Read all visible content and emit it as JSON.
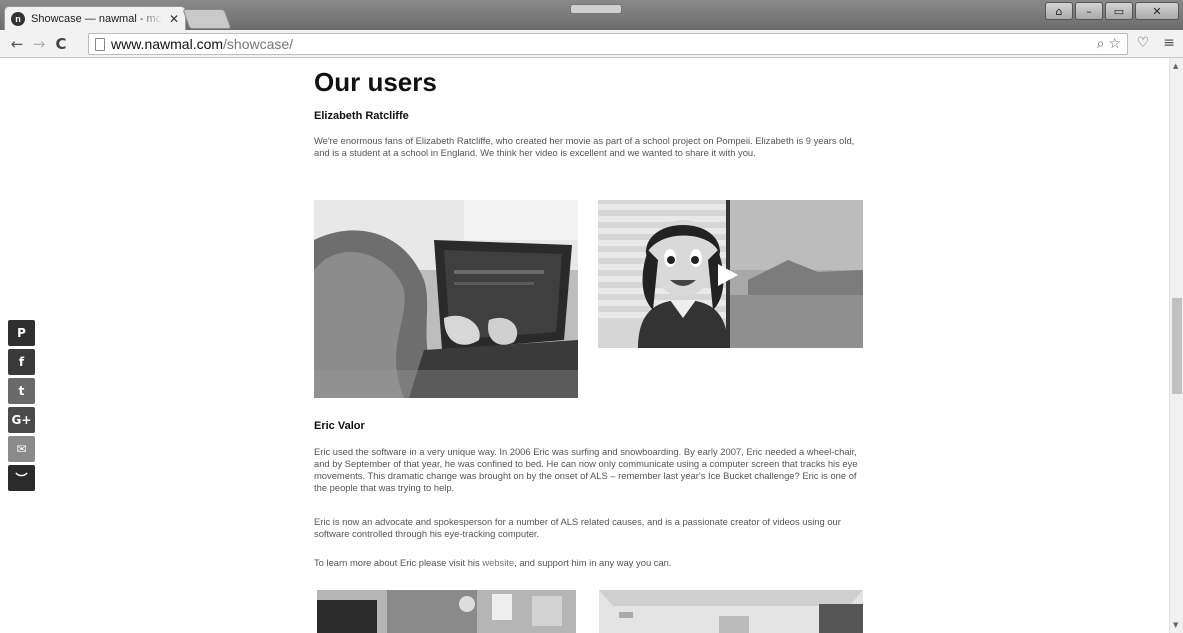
{
  "browser": {
    "tab_title": "Showcase — nawmal - mc",
    "tab_close": "✕",
    "favicon_letter": "n",
    "url_host": "www.nawmal.com",
    "url_path": "/showcase/",
    "window_controls": {
      "user": "⌂",
      "minimize": "–",
      "maximize": "▭",
      "close": "✕"
    },
    "icons": {
      "back": "←",
      "forward": "→",
      "reload": "C",
      "zoom": "⌕",
      "star": "☆",
      "pocket": "♡",
      "menu": "≡"
    }
  },
  "share": [
    {
      "name": "pinterest",
      "glyph": "P",
      "color": "#2f2f2f"
    },
    {
      "name": "facebook",
      "glyph": "f",
      "color": "#3a3a3a"
    },
    {
      "name": "twitter",
      "glyph": "t",
      "color": "#6a6a6a"
    },
    {
      "name": "google-plus",
      "glyph": "G+",
      "color": "#4a4a4a"
    },
    {
      "name": "email",
      "glyph": "✉",
      "color": "#8a8a8a"
    },
    {
      "name": "sumome",
      "glyph": "︶",
      "color": "#2a2a2a"
    }
  ],
  "page": {
    "heading": "Our users",
    "user1": {
      "name": "Elizabeth Ratcliffe",
      "bio": "We're enormous fans of Elizabeth Ratcliffe, who created her movie as part of a school project on Pompeii. Elizabeth is 9 years old, and is a student at a school in England. We think her video is excellent and we wanted to share it with you."
    },
    "user2": {
      "name": "Eric Valor",
      "bio1": "Eric used the software in a very unique way. In 2006 Eric was surfing and snowboarding. By early 2007, Eric needed a wheel-chair, and by September of that year, he was confined to bed. He can now only communicate using a computer screen that tracks his eye movements. This dramatic change was brought on by the onset of ALS – remember last year's Ice Bucket challenge? Eric is one of the people that was trying to help.",
      "bio2": "Eric is now an advocate and spokesperson for a number of ALS related causes, and is a passionate creator of videos using our software controlled through his eye-tracking computer.",
      "bio3_before": "To learn more about Eric please visit his ",
      "bio3_link": "website",
      "bio3_after": ", and support him in any way you can."
    }
  }
}
